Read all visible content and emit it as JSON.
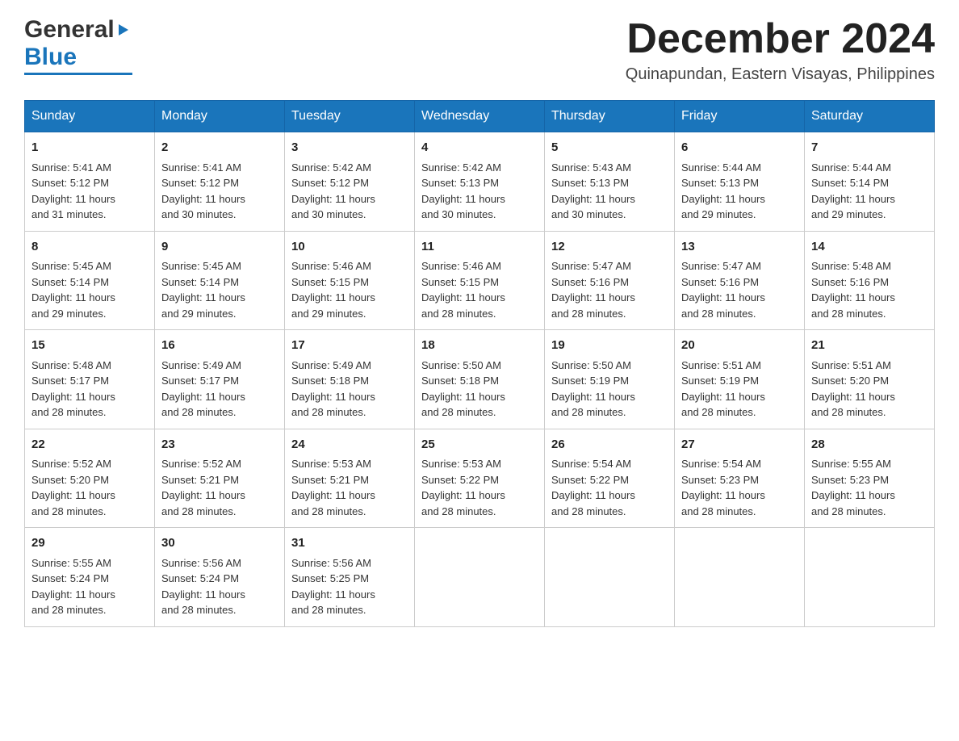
{
  "header": {
    "logo_general": "General",
    "logo_blue": "Blue",
    "month_year": "December 2024",
    "location": "Quinapundan, Eastern Visayas, Philippines"
  },
  "weekdays": [
    "Sunday",
    "Monday",
    "Tuesday",
    "Wednesday",
    "Thursday",
    "Friday",
    "Saturday"
  ],
  "weeks": [
    [
      {
        "day": "1",
        "sunrise": "5:41 AM",
        "sunset": "5:12 PM",
        "daylight": "11 hours and 31 minutes."
      },
      {
        "day": "2",
        "sunrise": "5:41 AM",
        "sunset": "5:12 PM",
        "daylight": "11 hours and 30 minutes."
      },
      {
        "day": "3",
        "sunrise": "5:42 AM",
        "sunset": "5:12 PM",
        "daylight": "11 hours and 30 minutes."
      },
      {
        "day": "4",
        "sunrise": "5:42 AM",
        "sunset": "5:13 PM",
        "daylight": "11 hours and 30 minutes."
      },
      {
        "day": "5",
        "sunrise": "5:43 AM",
        "sunset": "5:13 PM",
        "daylight": "11 hours and 30 minutes."
      },
      {
        "day": "6",
        "sunrise": "5:44 AM",
        "sunset": "5:13 PM",
        "daylight": "11 hours and 29 minutes."
      },
      {
        "day": "7",
        "sunrise": "5:44 AM",
        "sunset": "5:14 PM",
        "daylight": "11 hours and 29 minutes."
      }
    ],
    [
      {
        "day": "8",
        "sunrise": "5:45 AM",
        "sunset": "5:14 PM",
        "daylight": "11 hours and 29 minutes."
      },
      {
        "day": "9",
        "sunrise": "5:45 AM",
        "sunset": "5:14 PM",
        "daylight": "11 hours and 29 minutes."
      },
      {
        "day": "10",
        "sunrise": "5:46 AM",
        "sunset": "5:15 PM",
        "daylight": "11 hours and 29 minutes."
      },
      {
        "day": "11",
        "sunrise": "5:46 AM",
        "sunset": "5:15 PM",
        "daylight": "11 hours and 28 minutes."
      },
      {
        "day": "12",
        "sunrise": "5:47 AM",
        "sunset": "5:16 PM",
        "daylight": "11 hours and 28 minutes."
      },
      {
        "day": "13",
        "sunrise": "5:47 AM",
        "sunset": "5:16 PM",
        "daylight": "11 hours and 28 minutes."
      },
      {
        "day": "14",
        "sunrise": "5:48 AM",
        "sunset": "5:16 PM",
        "daylight": "11 hours and 28 minutes."
      }
    ],
    [
      {
        "day": "15",
        "sunrise": "5:48 AM",
        "sunset": "5:17 PM",
        "daylight": "11 hours and 28 minutes."
      },
      {
        "day": "16",
        "sunrise": "5:49 AM",
        "sunset": "5:17 PM",
        "daylight": "11 hours and 28 minutes."
      },
      {
        "day": "17",
        "sunrise": "5:49 AM",
        "sunset": "5:18 PM",
        "daylight": "11 hours and 28 minutes."
      },
      {
        "day": "18",
        "sunrise": "5:50 AM",
        "sunset": "5:18 PM",
        "daylight": "11 hours and 28 minutes."
      },
      {
        "day": "19",
        "sunrise": "5:50 AM",
        "sunset": "5:19 PM",
        "daylight": "11 hours and 28 minutes."
      },
      {
        "day": "20",
        "sunrise": "5:51 AM",
        "sunset": "5:19 PM",
        "daylight": "11 hours and 28 minutes."
      },
      {
        "day": "21",
        "sunrise": "5:51 AM",
        "sunset": "5:20 PM",
        "daylight": "11 hours and 28 minutes."
      }
    ],
    [
      {
        "day": "22",
        "sunrise": "5:52 AM",
        "sunset": "5:20 PM",
        "daylight": "11 hours and 28 minutes."
      },
      {
        "day": "23",
        "sunrise": "5:52 AM",
        "sunset": "5:21 PM",
        "daylight": "11 hours and 28 minutes."
      },
      {
        "day": "24",
        "sunrise": "5:53 AM",
        "sunset": "5:21 PM",
        "daylight": "11 hours and 28 minutes."
      },
      {
        "day": "25",
        "sunrise": "5:53 AM",
        "sunset": "5:22 PM",
        "daylight": "11 hours and 28 minutes."
      },
      {
        "day": "26",
        "sunrise": "5:54 AM",
        "sunset": "5:22 PM",
        "daylight": "11 hours and 28 minutes."
      },
      {
        "day": "27",
        "sunrise": "5:54 AM",
        "sunset": "5:23 PM",
        "daylight": "11 hours and 28 minutes."
      },
      {
        "day": "28",
        "sunrise": "5:55 AM",
        "sunset": "5:23 PM",
        "daylight": "11 hours and 28 minutes."
      }
    ],
    [
      {
        "day": "29",
        "sunrise": "5:55 AM",
        "sunset": "5:24 PM",
        "daylight": "11 hours and 28 minutes."
      },
      {
        "day": "30",
        "sunrise": "5:56 AM",
        "sunset": "5:24 PM",
        "daylight": "11 hours and 28 minutes."
      },
      {
        "day": "31",
        "sunrise": "5:56 AM",
        "sunset": "5:25 PM",
        "daylight": "11 hours and 28 minutes."
      },
      null,
      null,
      null,
      null
    ]
  ],
  "labels": {
    "sunrise": "Sunrise:",
    "sunset": "Sunset:",
    "daylight": "Daylight:"
  }
}
